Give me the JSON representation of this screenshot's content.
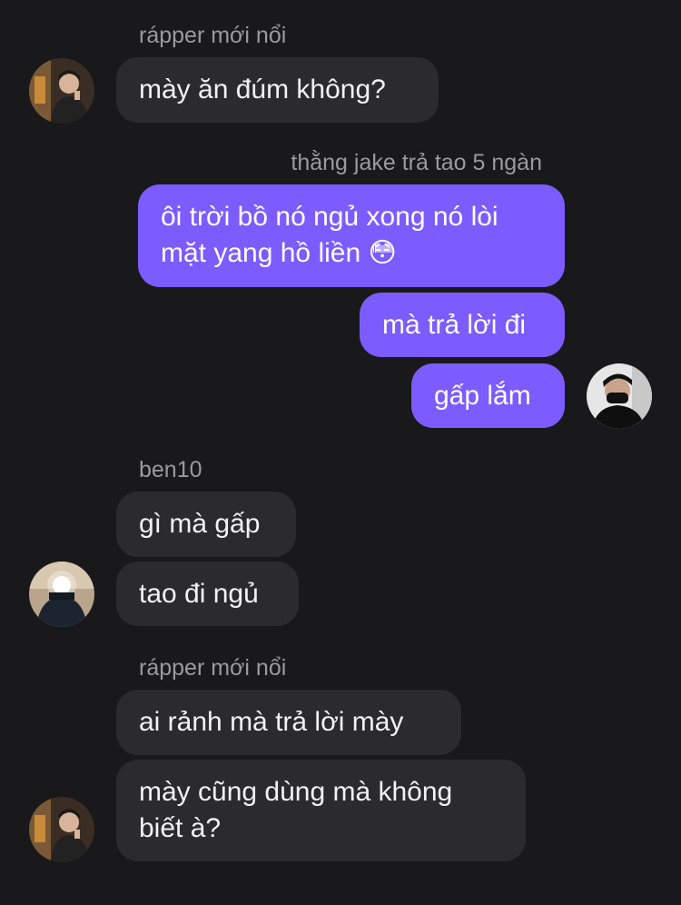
{
  "colors": {
    "background": "#19191b",
    "incoming_bubble": "#2b2b2e",
    "outgoing_bubble": "#7c5cff",
    "sender_name": "#9a9a9f",
    "text": "#f2f2f2"
  },
  "messages": {
    "group1": {
      "sender": "rápper mới nổi",
      "avatar_icon": "user-avatar-rapper",
      "bubbles": [
        "mày ăn đúm không?"
      ]
    },
    "group2": {
      "sender": "thằng jake trả tao 5 ngàn",
      "avatar_icon": "user-avatar-self",
      "bubbles": [
        "ôi trời bồ nó ngủ xong nó lòi\nmặt yang hồ liền 😳",
        "mà trả lời đi",
        "gấp lắm"
      ]
    },
    "group3": {
      "sender": "ben10",
      "avatar_icon": "user-avatar-ben10",
      "bubbles": [
        "gì mà gấp",
        "tao đi ngủ"
      ]
    },
    "group4": {
      "sender": "rápper mới nổi",
      "avatar_icon": "user-avatar-rapper",
      "bubbles": [
        "ai rảnh mà trả lời mày",
        "mày cũng dùng mà không\nbiết à?"
      ]
    }
  }
}
